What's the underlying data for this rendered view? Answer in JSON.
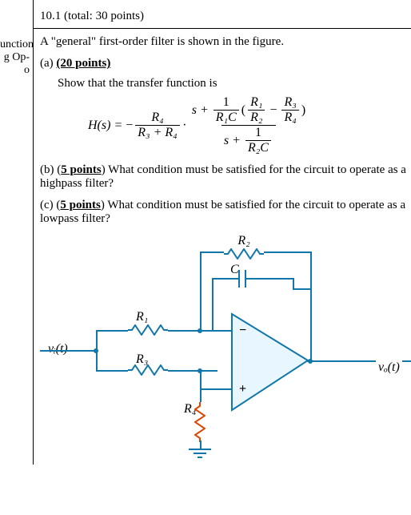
{
  "header": {
    "problem_number": "10.1",
    "total_label": "(total: 30 points)"
  },
  "left_stub": {
    "line1": "unction",
    "line2": "g Op-",
    "line3": "o"
  },
  "intro": "A \"general\" first-order filter is shown in the figure.",
  "parts": {
    "a": {
      "label": "(a)",
      "points": "(20 points)",
      "lead": "Show that the transfer function is"
    },
    "b": {
      "label": "(b)",
      "points": "(5 points)",
      "text": "What condition must be satisfied for the circuit to operate as a highpass filter?"
    },
    "c": {
      "label": "(c)",
      "points": "(5 points)",
      "text": "What condition must be satisfied for the circuit to operate as a lowpass filter?"
    }
  },
  "formula": {
    "lhs": "H(s) =",
    "minus": "−",
    "frac1_num": "R₄",
    "frac1_den": "R₃ + R₄",
    "dot": "·",
    "big_num_prefix": "s +",
    "inv_R1C_num": "1",
    "inv_R1C_den": "R₁C",
    "open": "(",
    "ratioA_num": "R₁",
    "ratioA_den": "R₂",
    "minus2": "−",
    "ratioB_num": "R₃",
    "ratioB_den": "R₄",
    "close": ")",
    "big_den_prefix": "s +",
    "inv_R2C_num": "1",
    "inv_R2C_den": "R₂C"
  },
  "circuit": {
    "vin": "vᵢ(t)",
    "vout": "vₒ(t)",
    "R1": "R₁",
    "R2": "R₂",
    "R3": "R₃",
    "R4": "R₄",
    "C": "C",
    "opamp_plus": "+",
    "opamp_minus": "−"
  }
}
